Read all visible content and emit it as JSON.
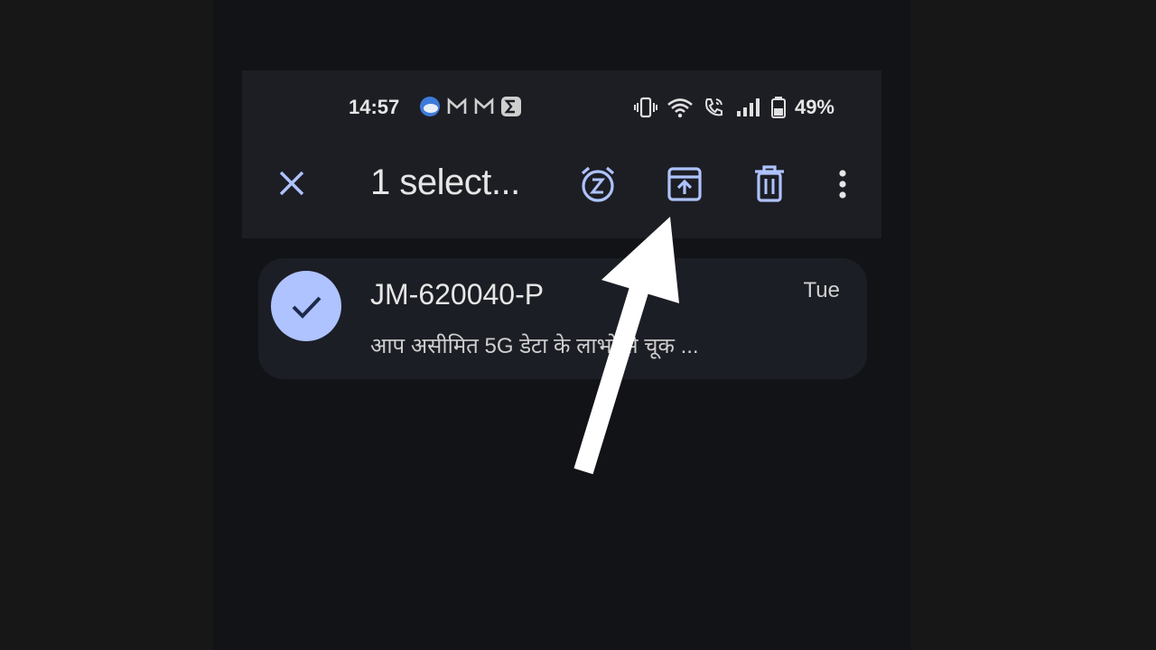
{
  "status_bar": {
    "time": "14:57",
    "battery_percent": "49%"
  },
  "action_bar": {
    "title": "1 select..."
  },
  "email": {
    "sender": "JM-620040-P",
    "date": "Tue",
    "snippet": "आप असीमित 5G डेटा के लाभों से चूक ..."
  },
  "colors": {
    "accent": "#aec3ff",
    "topbar_bg": "#1d1e24",
    "card_bg": "#1c1e25"
  }
}
